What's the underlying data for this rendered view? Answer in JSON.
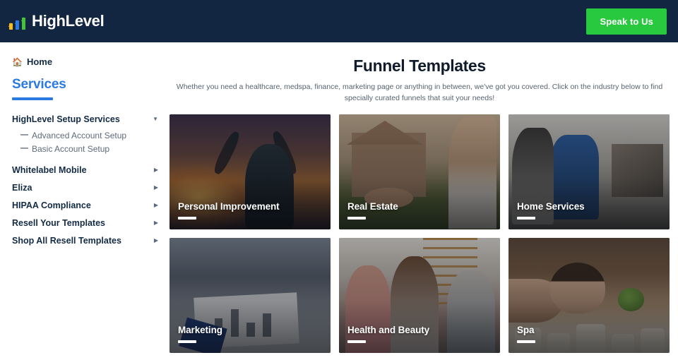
{
  "header": {
    "brand_name": "HighLevel",
    "logo_icon": "three-up-arrows-icon",
    "cta_label": "Speak to Us",
    "background_color": "#122641",
    "cta_color": "#28c93f"
  },
  "sidebar": {
    "home_label": "Home",
    "home_icon": "house-icon",
    "section_title": "Services",
    "accent_color": "#2a7ae2",
    "items": [
      {
        "label": "HighLevel Setup Services",
        "chevron": "chevron-down-icon",
        "expanded": true,
        "children": [
          {
            "label": "Advanced Account Setup"
          },
          {
            "label": "Basic Account Setup"
          }
        ]
      },
      {
        "label": "Whitelabel Mobile",
        "chevron": "chevron-right-icon",
        "expanded": false
      },
      {
        "label": "Eliza",
        "chevron": "chevron-right-icon",
        "expanded": false
      },
      {
        "label": "HIPAA Compliance",
        "chevron": "chevron-right-icon",
        "expanded": false
      },
      {
        "label": "Resell Your Templates",
        "chevron": "chevron-right-icon",
        "expanded": false
      },
      {
        "label": "Shop All Resell Templates",
        "chevron": "chevron-right-icon",
        "expanded": false
      }
    ]
  },
  "main": {
    "title": "Funnel Templates",
    "subtitle": "Whether you need a healthcare, medspa, finance, marketing page or anything in between, we've got you covered. Click on the industry below to find specially curated funnels that suit your needs!",
    "cards": [
      {
        "title": "Personal Improvement",
        "art": "silhouette-arms-raised-sunset"
      },
      {
        "title": "Real Estate",
        "art": "handing-house-keys"
      },
      {
        "title": "Home Services",
        "art": "technician-repairing-appliance"
      },
      {
        "title": "Marketing",
        "art": "team-reviewing-charts"
      },
      {
        "title": "Health and Beauty",
        "art": "three-women-laughing-gym"
      },
      {
        "title": "Spa",
        "art": "woman-massage-candles"
      }
    ]
  }
}
